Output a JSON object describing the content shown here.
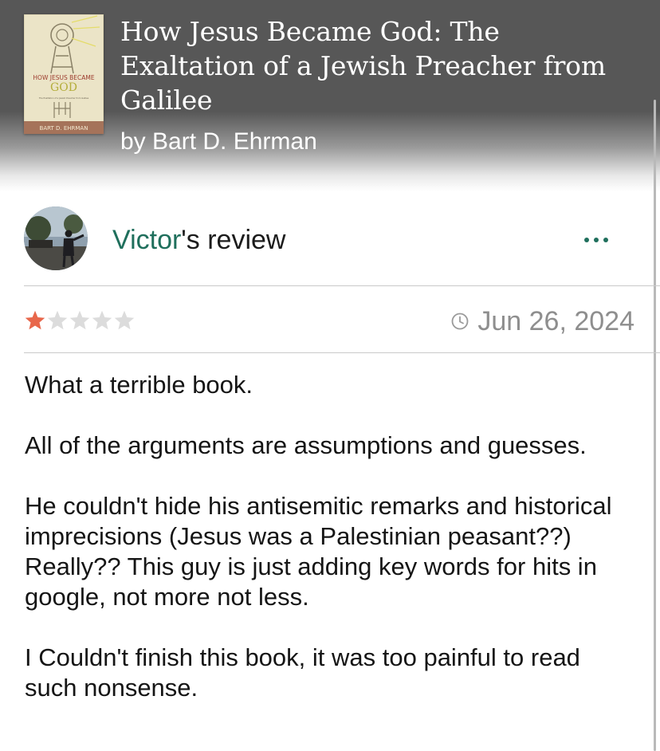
{
  "book": {
    "title": "How Jesus Became God: The Exaltation of a Jewish Preacher from Galilee",
    "author_line": "by Bart D. Ehrman",
    "cover": {
      "top_text": "HOW JESUS BECAME",
      "big_text": "GOD",
      "subtitle_text": "The Exaltation of a Jewish Preacher from Galilee",
      "author_text": "BART D. EHRMAN"
    }
  },
  "review": {
    "reviewer_name": "Victor",
    "heading_suffix": "'s review",
    "rating": 1,
    "max_rating": 5,
    "date": "Jun 26, 2024",
    "paragraphs": [
      "What a terrible book.",
      "All of the arguments are assumptions and guesses.",
      "He couldn't hide his antisemitic remarks and historical imprecisions (Jesus was a Palestinian peasant??) Really?? This guy is just adding key words for hits in google, not more not less.",
      "I Couldn't finish this book, it was too painful to read such nonsense."
    ]
  },
  "icons": {
    "more": "ellipsis-icon",
    "date": "clock-icon",
    "star_filled": "star-filled-icon",
    "star_empty": "star-empty-icon"
  },
  "colors": {
    "accent": "#1f6f5c",
    "star_filled": "#e8674b",
    "star_empty": "#dcdcdc",
    "date_text": "#8e8e8e"
  }
}
